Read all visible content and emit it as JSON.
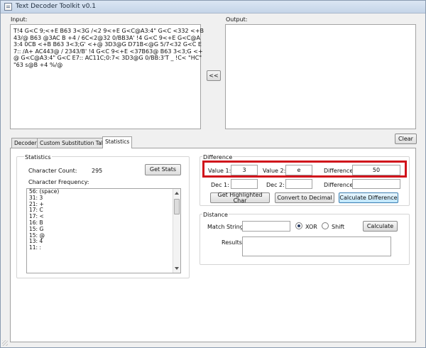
{
  "window": {
    "title": "Text Decoder Toolkit v0.1"
  },
  "input": {
    "label": "Input:",
    "value": "T!4 G<C 9;<+E B63 3<3G /<2 9<+E G<C@A3:4\" G<C <332 <+B 43/@ B63 @3AC B +4 / 6C<2@32 0/BB3A' !4 G<C 9<+E G<C@A3:4 0CB <+B B63 3<3;G' <+@ 3D3@G D71B<@G 5/7<32 G<C E7:: /A+ AC443@ / 2343/B' !4 G<C 9<+E <37B63@ B63 3<3;G <+@ G<C@A3:4\" G<C E7:: AC11C;0:7< 3D3@G 0/BB:3'T _ !C< \"HC\" \"63 s@B +4 %/@"
  },
  "output": {
    "label": "Output:",
    "value": ""
  },
  "copy_button": {
    "label": "<<"
  },
  "clear_button": {
    "label": "Clear"
  },
  "tabs": [
    {
      "label": "Decoder"
    },
    {
      "label": "Custom Substitution Table"
    },
    {
      "label": "Statistics"
    }
  ],
  "statistics": {
    "group_label": "Statistics",
    "char_count_label": "Character Count:",
    "char_count_value": "295",
    "get_stats_label": "Get Stats",
    "freq_label": "Character Frequency:",
    "freq_items": [
      "56: (space)",
      "31: 3",
      "21: +",
      "17: C",
      "17: <",
      "16: B",
      "15: G",
      "15: @",
      "13: 4",
      "11: :"
    ]
  },
  "difference": {
    "group_label": "Difference",
    "value1_label": "Value 1:",
    "value1": "3",
    "value2_label": "Value 2:",
    "value2": "e",
    "diff_label": "Difference:",
    "diff_value": "50",
    "dec1_label": "Dec 1:",
    "dec1": "",
    "dec2_label": "Dec 2:",
    "dec2": "",
    "dec_diff_label": "Difference:",
    "dec_diff": "",
    "get_char_label": "Get Highlighted Char",
    "to_decimal_label": "Convert to Decimal",
    "calc_diff_label": "Calculate Difference"
  },
  "distance": {
    "group_label": "Distance",
    "match_label": "Match String:",
    "match_value": "",
    "xor_label": "XOR",
    "shift_label": "Shift",
    "selected": "XOR",
    "calculate_label": "Calculate",
    "results_label": "Results:",
    "results_value": ""
  },
  "colors": {
    "highlight": "#d0121b",
    "accent_border": "#3c7fb1"
  }
}
